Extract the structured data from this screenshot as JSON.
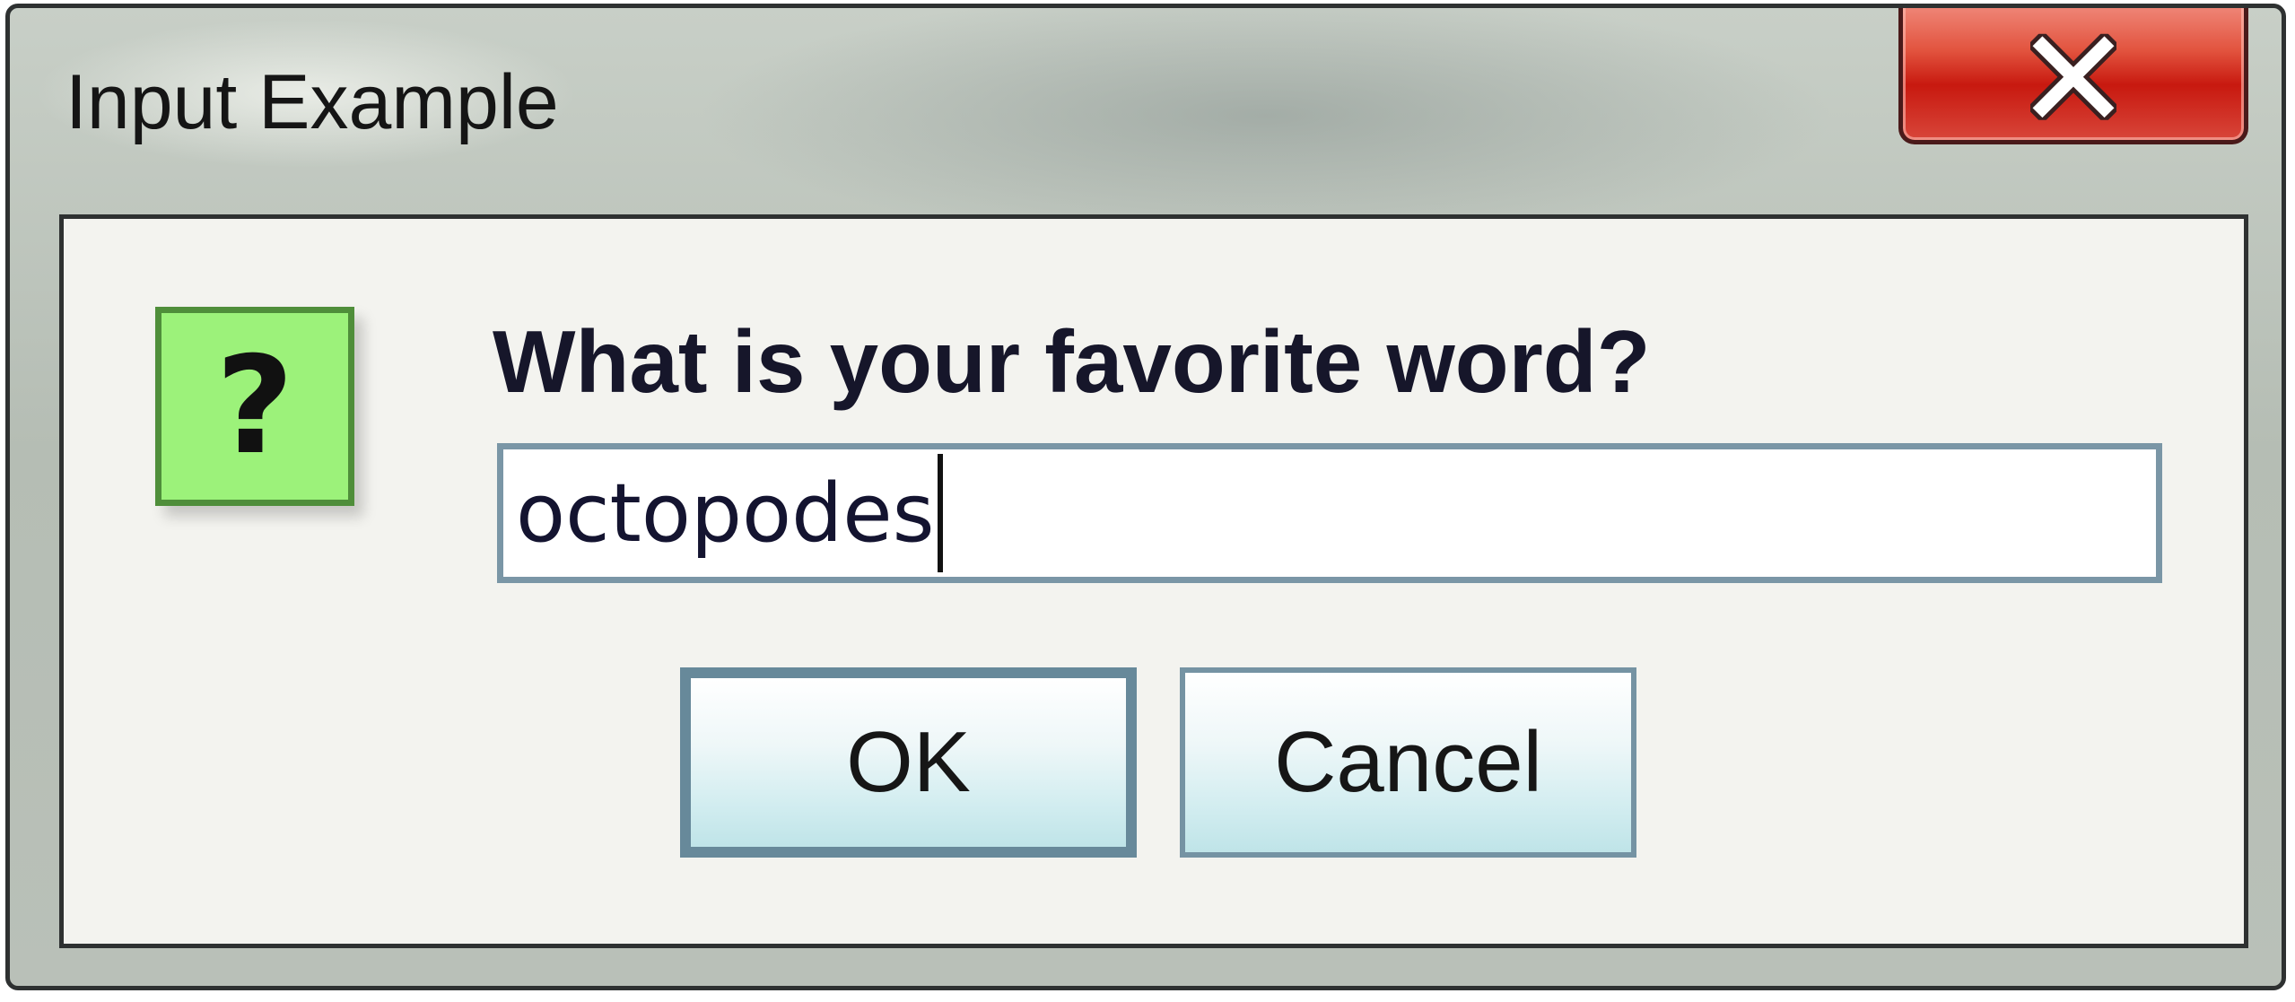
{
  "window": {
    "title": "Input Example",
    "close_icon": "close-icon"
  },
  "dialog": {
    "icon": "question-icon",
    "icon_glyph": "?",
    "prompt": "What is your favorite word?",
    "input_value": "octopodes",
    "ok_label": "OK",
    "cancel_label": "Cancel"
  },
  "colors": {
    "question_icon_fill": "#9cf27a",
    "question_icon_border": "#4f8e3a",
    "close_button": "#c8190f",
    "button_border": "#67899a"
  }
}
